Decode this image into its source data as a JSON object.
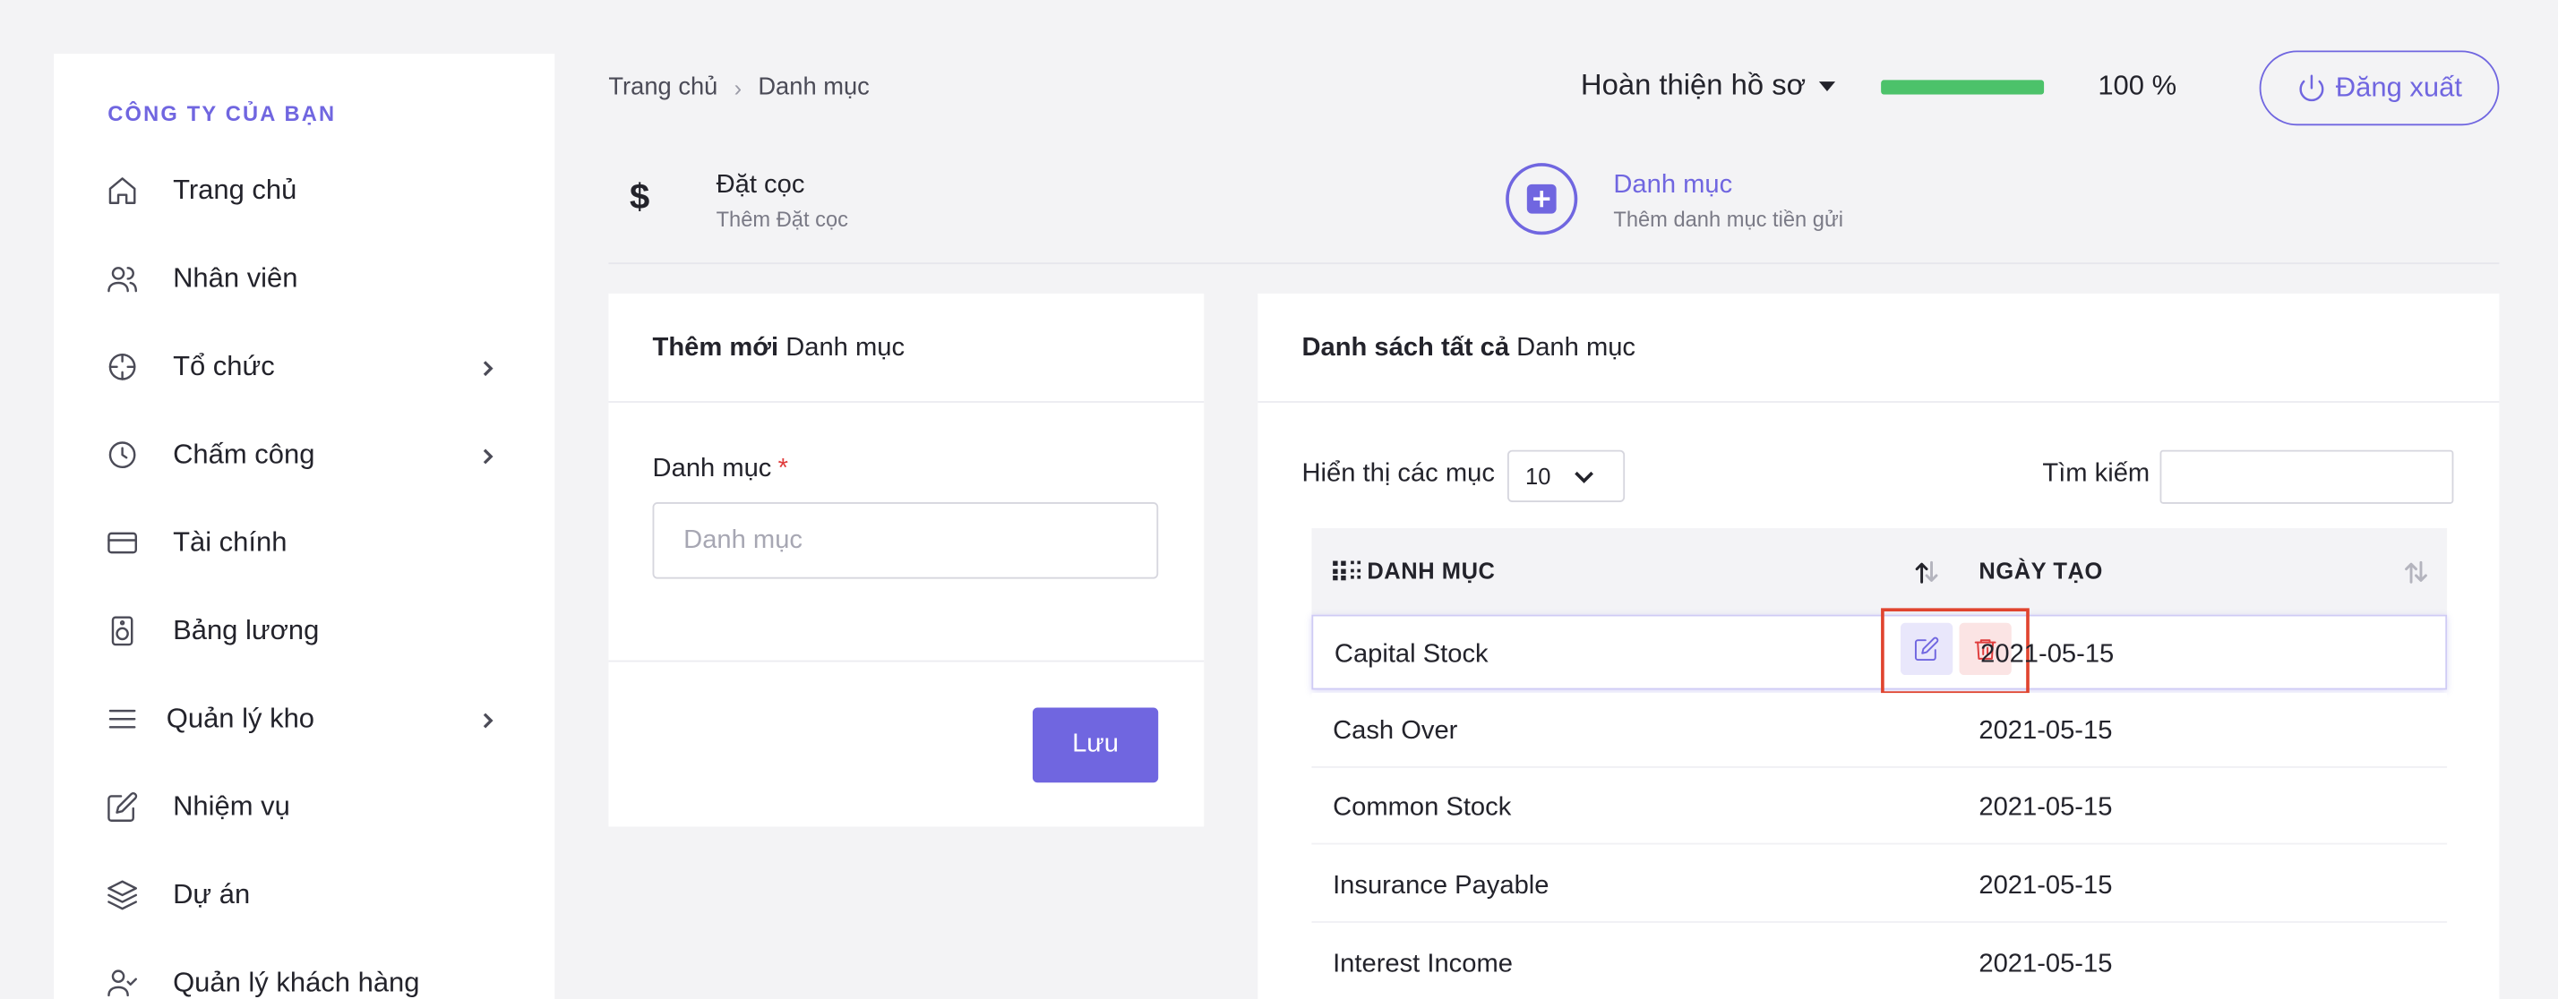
{
  "sidebar": {
    "company": "CÔNG TY CỦA BẠN",
    "items": [
      {
        "label": "Trang chủ",
        "icon": "home-icon",
        "chevron": false
      },
      {
        "label": "Nhân viên",
        "icon": "users-icon",
        "chevron": false
      },
      {
        "label": "Tổ chức",
        "icon": "crosshair-icon",
        "chevron": true
      },
      {
        "label": "Chấm công",
        "icon": "clock-icon",
        "chevron": true
      },
      {
        "label": "Tài chính",
        "icon": "credit-card-icon",
        "chevron": false
      },
      {
        "label": "Bảng lương",
        "icon": "speaker-icon",
        "chevron": false
      },
      {
        "label": "Quản lý kho",
        "icon": "menu-icon",
        "chevron": true
      },
      {
        "label": "Nhiệm vụ",
        "icon": "edit-icon",
        "chevron": false
      },
      {
        "label": "Dự án",
        "icon": "layers-icon",
        "chevron": false
      },
      {
        "label": "Quản lý khách hàng",
        "icon": "user-check-icon",
        "chevron": false
      }
    ]
  },
  "breadcrumb": {
    "home": "Trang chủ",
    "sep": "›",
    "current": "Danh mục"
  },
  "header": {
    "profile_label": "Hoàn thiện hồ sơ",
    "progress_percent": 100,
    "progress_text": "100 %",
    "logout_label": "Đăng xuất"
  },
  "steps": {
    "deposit": {
      "icon": "dollar-icon",
      "title": "Đặt cọc",
      "subtitle": "Thêm Đặt cọc"
    },
    "category": {
      "icon": "plus-square-icon",
      "title": "Danh mục",
      "subtitle": "Thêm danh mục tiền gửi"
    }
  },
  "form_card": {
    "title_bold": "Thêm mới",
    "title_rest": " Danh mục",
    "field_label": "Danh mục",
    "required_mark": "*",
    "placeholder": "Danh mục",
    "value": "",
    "save_label": "Lưu"
  },
  "list_card": {
    "title_bold": "Danh sách tất cả",
    "title_rest": " Danh mục",
    "show_label": "Hiển thị các mục",
    "page_size": "10",
    "search_label": "Tìm kiếm",
    "search_value": "",
    "columns": [
      "DANH MỤC",
      "NGÀY TẠO"
    ],
    "rows": [
      {
        "name": "Capital Stock",
        "date": "2021-05-15"
      },
      {
        "name": "Cash Over",
        "date": "2021-05-15"
      },
      {
        "name": "Common Stock",
        "date": "2021-05-15"
      },
      {
        "name": "Insurance Payable",
        "date": "2021-05-15"
      },
      {
        "name": "Interest Income",
        "date": "2021-05-15"
      }
    ]
  },
  "colors": {
    "accent": "#7066e0",
    "progress": "#4cc26a",
    "danger": "#e03c3c",
    "highlight_box": "#e0442f"
  }
}
